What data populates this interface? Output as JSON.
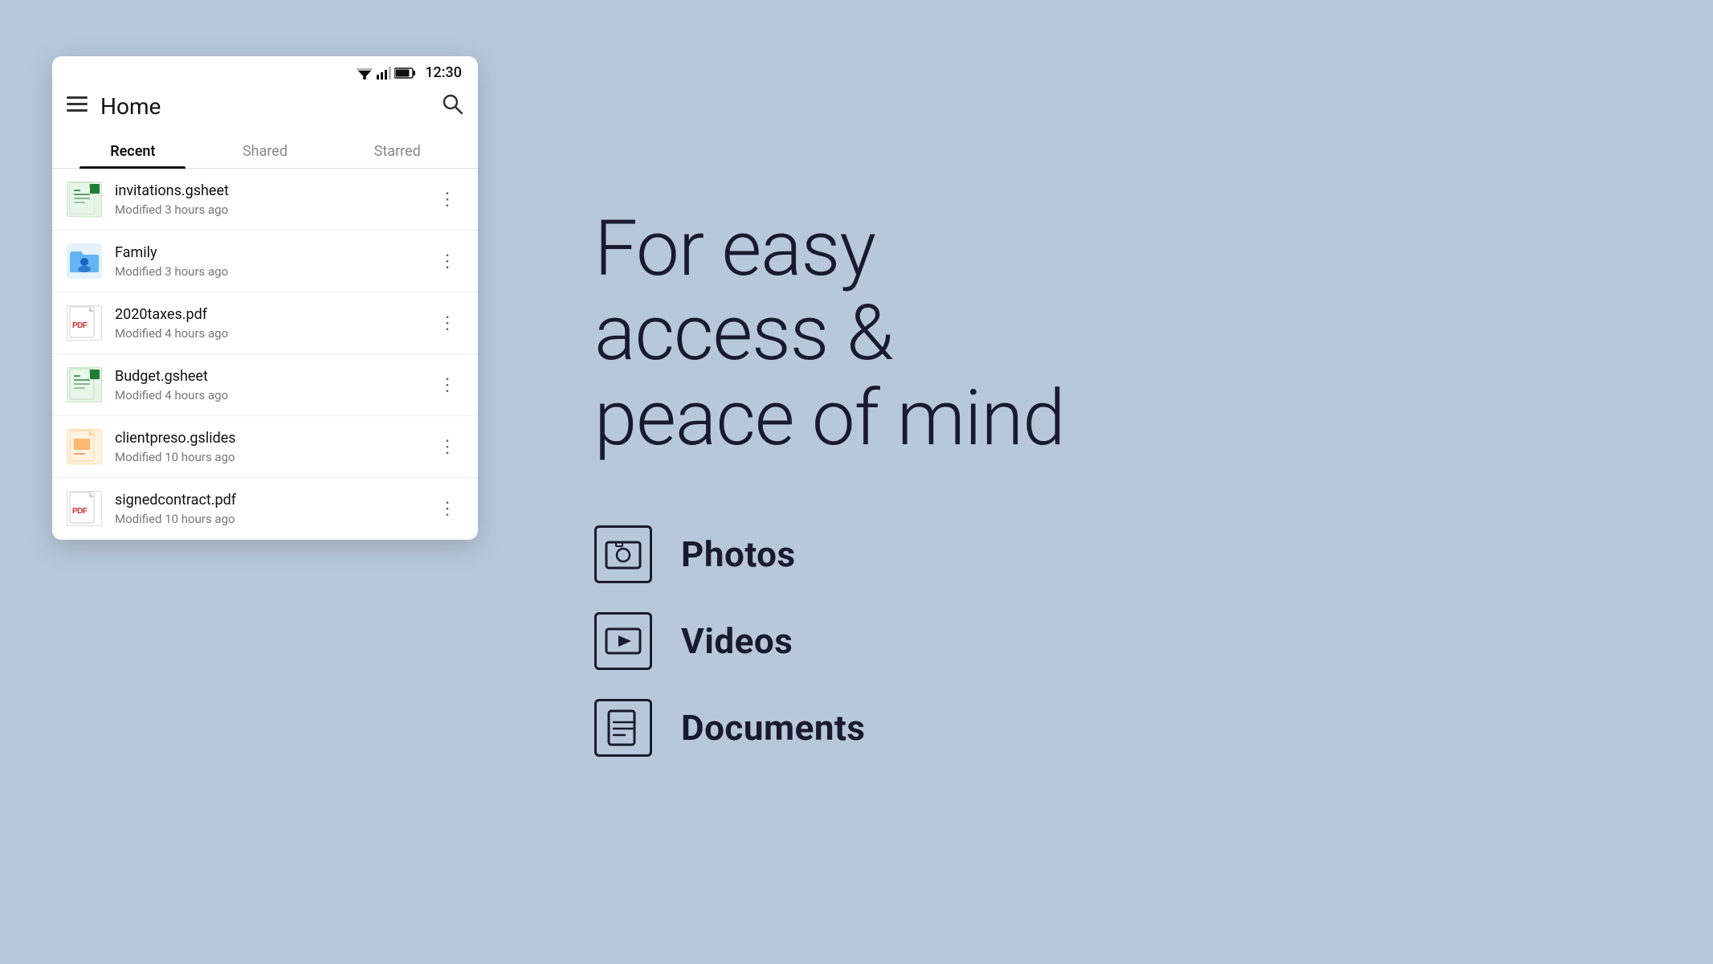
{
  "statusBar": {
    "time": "12:30"
  },
  "header": {
    "menuIcon": "≡",
    "title": "Home",
    "searchIcon": "🔍"
  },
  "tabs": [
    {
      "id": "recent",
      "label": "Recent",
      "active": true
    },
    {
      "id": "shared",
      "label": "Shared",
      "active": false
    },
    {
      "id": "starred",
      "label": "Starred",
      "active": false
    }
  ],
  "files": [
    {
      "id": "invitations",
      "name": "invitations.gsheet",
      "meta": "Modified 3 hours ago",
      "type": "gsheet"
    },
    {
      "id": "family",
      "name": "Family",
      "meta": "Modified 3 hours ago",
      "type": "folder-shared"
    },
    {
      "id": "2020taxes",
      "name": "2020taxes.pdf",
      "meta": "Modified 4 hours ago",
      "type": "pdf"
    },
    {
      "id": "budget",
      "name": "Budget.gsheet",
      "meta": "Modified 4 hours ago",
      "type": "gsheet"
    },
    {
      "id": "clientpreso",
      "name": "clientpreso.gslides",
      "meta": "Modified 10 hours ago",
      "type": "gslides"
    },
    {
      "id": "signedcontract",
      "name": "signedcontract.pdf",
      "meta": "Modified 10 hours ago",
      "type": "pdf"
    }
  ],
  "hero": {
    "line1": "For easy",
    "line2": "access &",
    "line3": "peace of mind"
  },
  "features": [
    {
      "id": "photos",
      "label": "Photos",
      "iconType": "photo"
    },
    {
      "id": "videos",
      "label": "Videos",
      "iconType": "video"
    },
    {
      "id": "documents",
      "label": "Documents",
      "iconType": "document"
    }
  ]
}
